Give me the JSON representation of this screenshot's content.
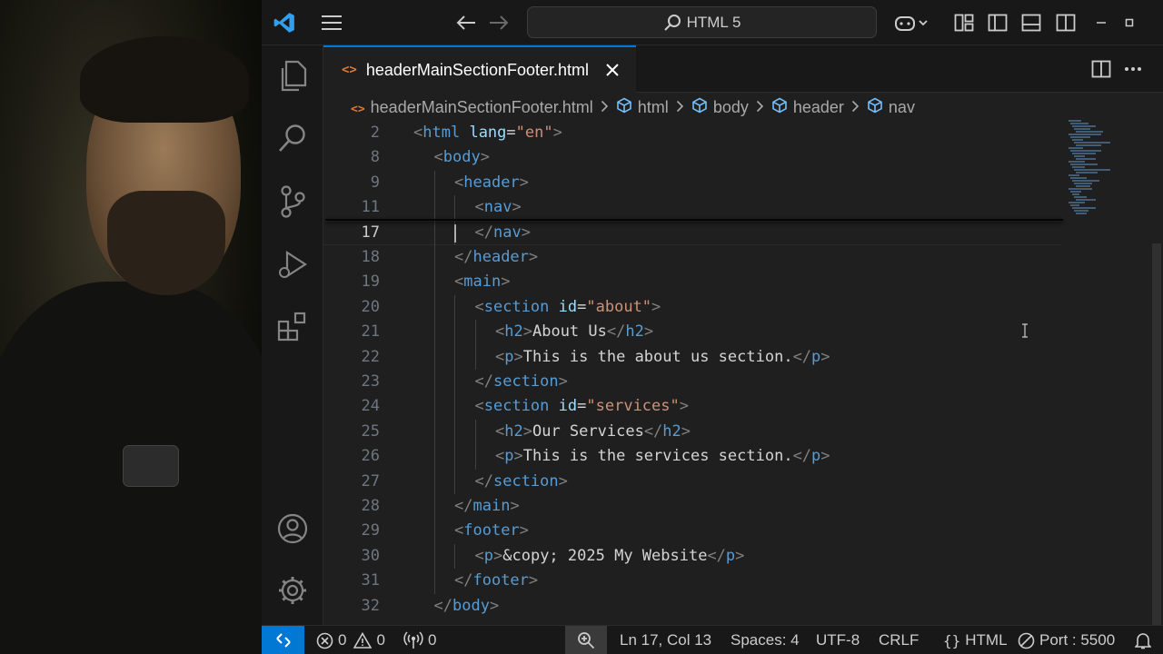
{
  "titlebar": {
    "search_text": "HTML 5"
  },
  "tab": {
    "filename": "headerMainSectionFooter.html",
    "icon": "<>"
  },
  "breadcrumb": [
    {
      "label": "headerMainSectionFooter.html",
      "icon": "html-file-icon"
    },
    {
      "label": "html",
      "icon": "symbol-field-icon"
    },
    {
      "label": "body",
      "icon": "symbol-field-icon"
    },
    {
      "label": "header",
      "icon": "symbol-field-icon"
    },
    {
      "label": "nav",
      "icon": "symbol-field-icon"
    }
  ],
  "code_lines": [
    {
      "n": "2",
      "indent": 0,
      "text": "<html lang=\"en\">"
    },
    {
      "n": "8",
      "indent": 1,
      "text": "<body>"
    },
    {
      "n": "9",
      "indent": 2,
      "text": "<header>"
    },
    {
      "n": "11",
      "indent": 3,
      "text": "<nav>"
    },
    {
      "n": "17",
      "indent": 3,
      "text": "</nav>",
      "current": true
    },
    {
      "n": "18",
      "indent": 2,
      "text": "</header>"
    },
    {
      "n": "19",
      "indent": 2,
      "text": "<main>"
    },
    {
      "n": "20",
      "indent": 3,
      "text": "<section id=\"about\">"
    },
    {
      "n": "21",
      "indent": 4,
      "text": "<h2>About Us</h2>"
    },
    {
      "n": "22",
      "indent": 4,
      "text": "<p>This is the about us section.</p>"
    },
    {
      "n": "23",
      "indent": 3,
      "text": "</section>"
    },
    {
      "n": "24",
      "indent": 3,
      "text": "<section id=\"services\">"
    },
    {
      "n": "25",
      "indent": 4,
      "text": "<h2>Our Services</h2>"
    },
    {
      "n": "26",
      "indent": 4,
      "text": "<p>This is the services section.</p>"
    },
    {
      "n": "27",
      "indent": 3,
      "text": "</section>"
    },
    {
      "n": "28",
      "indent": 2,
      "text": "</main>"
    },
    {
      "n": "29",
      "indent": 2,
      "text": "<footer>"
    },
    {
      "n": "30",
      "indent": 3,
      "text": "<p>&copy; 2025 My Website</p>"
    },
    {
      "n": "31",
      "indent": 2,
      "text": "</footer>"
    },
    {
      "n": "32",
      "indent": 1,
      "text": "</body>"
    }
  ],
  "statusbar": {
    "errors": "0",
    "warnings": "0",
    "ports": "0",
    "position": "Ln 17, Col 13",
    "spaces": "Spaces: 4",
    "encoding": "UTF-8",
    "eol": "CRLF",
    "language": "HTML",
    "port": "Port : 5500"
  },
  "colors": {
    "accent": "#0078d4",
    "tag": "#569cd6",
    "attribute": "#9cdcfe",
    "string": "#ce9178",
    "punctuation": "#808080"
  }
}
